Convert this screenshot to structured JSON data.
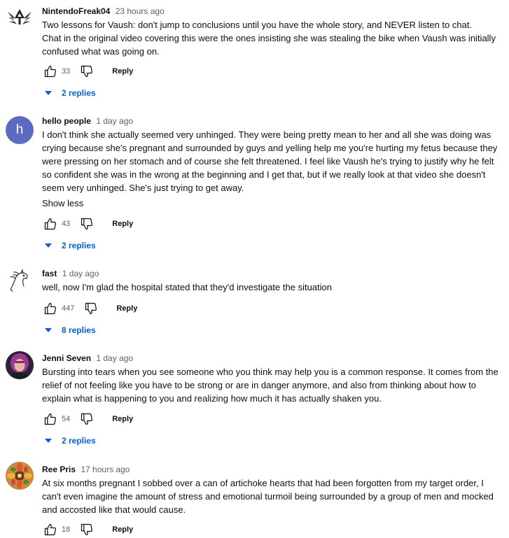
{
  "comments": [
    {
      "author": "NintendoFreak04",
      "time": "23 hours ago",
      "text": "Two lessons for Vaush: don't jump to conclusions until you have the whole story, and NEVER listen to chat.\nChat in the original video covering this were the ones insisting she was stealing the bike when Vaush was initially confused what was going on.",
      "likes": "33",
      "reply_label": "Reply",
      "replies_label": "2 replies",
      "avatar_icon": "triforce-crest-icon"
    },
    {
      "author": "hello people",
      "time": "1 day ago",
      "avatar_letter": "h",
      "avatar_color": "#5c6bc0",
      "text": "I don't think she actually seemed very unhinged. They were being pretty mean to her and all she was doing was crying because she's pregnant and surrounded by guys and yelling help me you're hurting my fetus because they were pressing on her stomach and of course she felt threatened. I feel like Vaush he's trying to justify why he felt so confident she was in the wrong at the beginning and I get that, but if we really look at that video she doesn't seem very unhinged. She's just trying to get away.",
      "show_less": "Show less",
      "likes": "43",
      "reply_label": "Reply",
      "replies_label": "2 replies"
    },
    {
      "author": "fast",
      "time": "1 day ago",
      "text": "well, now I'm glad the hospital stated that they'd investigate the situation",
      "likes": "447",
      "reply_label": "Reply",
      "replies_label": "8 replies",
      "avatar_icon": "horse-head-sketch-icon"
    },
    {
      "author": "Jenni Seven",
      "time": "1 day ago",
      "text": "Bursting into tears when you see someone who you think may help you is a common response. It comes from the relief of not feeling like you have to be strong or are in danger anymore, and also from thinking about how to explain what is happening to you and realizing how much it has actually shaken you.",
      "likes": "54",
      "reply_label": "Reply",
      "replies_label": "2 replies",
      "avatar_icon": "profile-photo-icon"
    },
    {
      "author": "Ree Pris",
      "time": "17 hours ago",
      "text": "At six months pregnant I sobbed over a can of artichoke hearts that had been forgotten from my target order, I can't even imagine the amount of stress and emotional turmoil being surrounded by a group of men and mocked and accosted like that would cause.",
      "likes": "18",
      "reply_label": "Reply",
      "avatar_icon": "flower-artwork-icon"
    }
  ],
  "colors": {
    "link_blue": "#065fd4",
    "meta_gray": "#606060",
    "text": "#0f0f0f"
  }
}
